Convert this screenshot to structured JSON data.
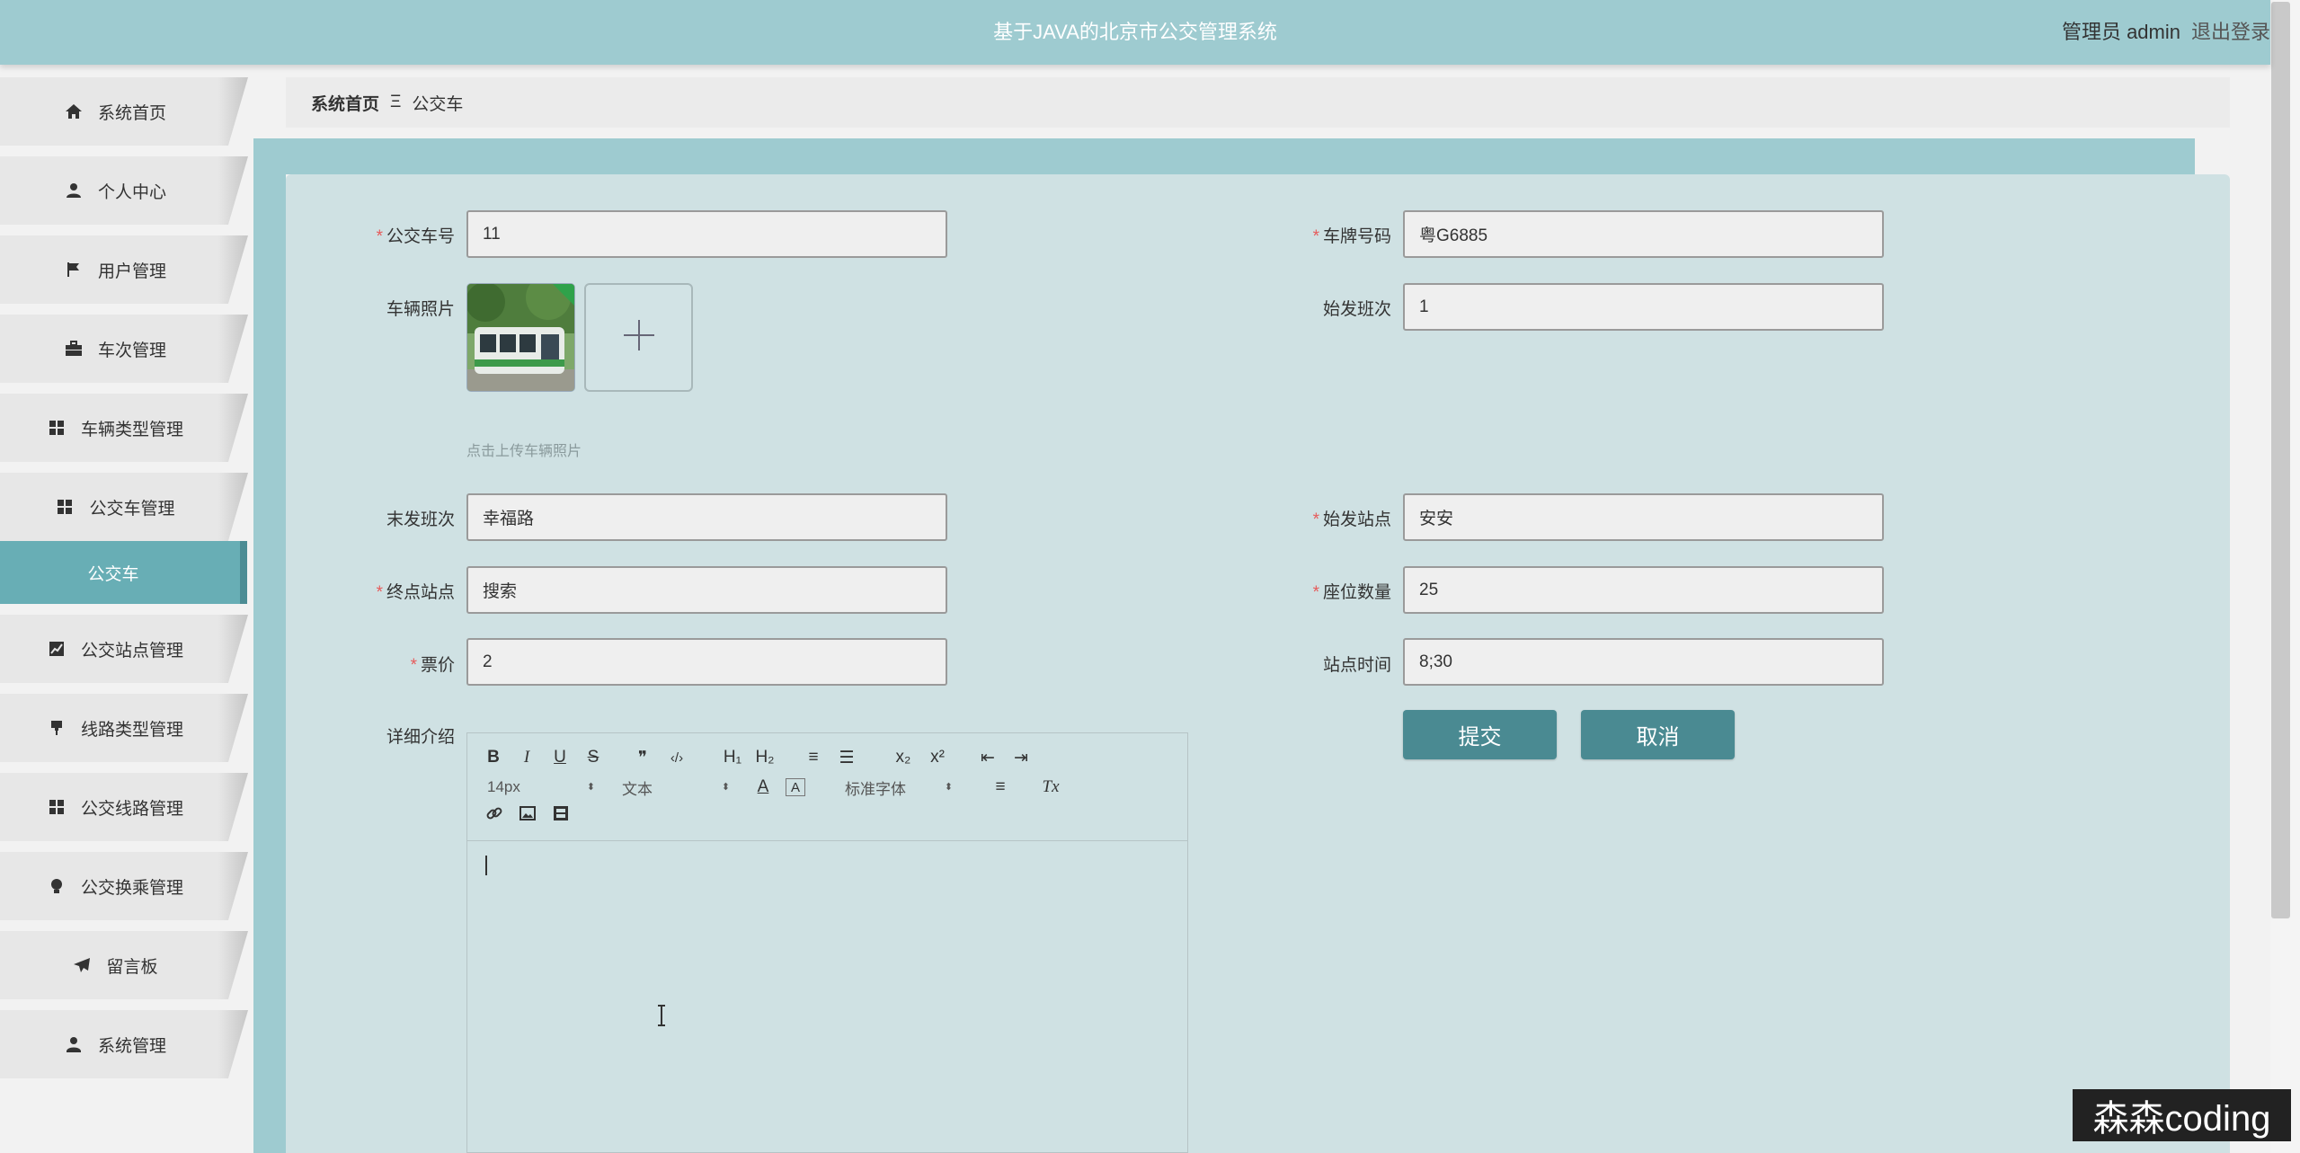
{
  "header": {
    "title": "基于JAVA的北京市公交管理系统",
    "user_label": "管理员 admin",
    "logout_label": "退出登录"
  },
  "sidebar": {
    "items": [
      {
        "label": "系统首页",
        "icon": "home-icon"
      },
      {
        "label": "个人中心",
        "icon": "user-icon"
      },
      {
        "label": "用户管理",
        "icon": "flag-icon"
      },
      {
        "label": "车次管理",
        "icon": "briefcase-icon"
      },
      {
        "label": "车辆类型管理",
        "icon": "grid-icon"
      },
      {
        "label": "公交车管理",
        "icon": "grid-icon"
      },
      {
        "label": "公交站点管理",
        "icon": "chart-icon"
      },
      {
        "label": "线路类型管理",
        "icon": "pin-icon"
      },
      {
        "label": "公交线路管理",
        "icon": "grid-icon"
      },
      {
        "label": "公交换乘管理",
        "icon": "bulb-icon"
      },
      {
        "label": "留言板",
        "icon": "send-icon"
      },
      {
        "label": "系统管理",
        "icon": "user-admin-icon"
      }
    ],
    "active_subitem": "公交车"
  },
  "breadcrumb": {
    "home": "系统首页",
    "separator": "Ξ",
    "current": "公交车"
  },
  "form": {
    "bus_no": {
      "label": "公交车号",
      "value": "11",
      "required": true
    },
    "plate_no": {
      "label": "车牌号码",
      "value": "粤G6885",
      "required": true
    },
    "photo": {
      "label": "车辆照片",
      "hint": "点击上传车辆照片"
    },
    "first_shift": {
      "label": "始发班次",
      "value": "1",
      "required": false
    },
    "last_shift": {
      "label": "末发班次",
      "value": "幸福路",
      "required": false
    },
    "start_station": {
      "label": "始发站点",
      "value": "安安",
      "required": true
    },
    "end_station": {
      "label": "终点站点",
      "value": "搜索",
      "required": true
    },
    "seats": {
      "label": "座位数量",
      "value": "25",
      "required": true
    },
    "fare": {
      "label": "票价",
      "value": "2",
      "required": true
    },
    "station_time": {
      "label": "站点时间",
      "value": "8;30",
      "required": false
    },
    "description": {
      "label": "详细介绍"
    }
  },
  "buttons": {
    "submit": "提交",
    "cancel": "取消"
  },
  "editor": {
    "font_size": "14px",
    "block_type": "文本",
    "font_family": "标准字体",
    "tools": {
      "bold": "B",
      "italic": "I",
      "underline": "U",
      "strike": "S",
      "quote": "❞",
      "code": "‹/›",
      "h1": "H₁",
      "h2": "H₂",
      "ordered_list": "≡",
      "bullet_list": "☰",
      "subscript": "x₂",
      "superscript": "x²",
      "outdent": "⇤",
      "indent": "⇥",
      "font_color": "A",
      "bg_color": "A",
      "align": "≡",
      "clear_format": "Tx"
    }
  },
  "watermark": "森森coding",
  "colors": {
    "header_bg": "#9ecbd0",
    "card_bg": "#cfe1e3",
    "button_bg": "#4a8a92",
    "active_menu_bg": "#68aeb5",
    "required_star": "#e65b5b"
  }
}
